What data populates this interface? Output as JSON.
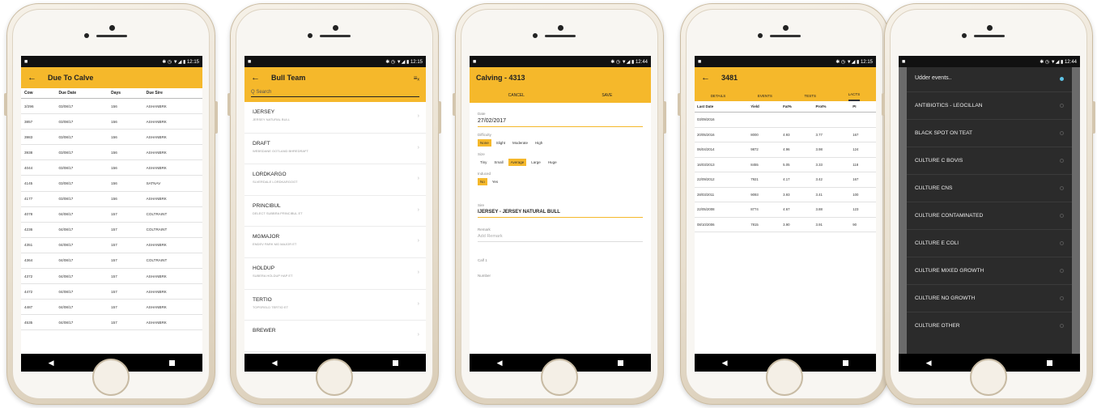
{
  "status": {
    "left": "■",
    "right": "✱ ◷ ▼◢ ▮ 12:15",
    "right_alt": "✱ ◷ ▼◢ ▮ 12:44"
  },
  "nav": {
    "back": "◀"
  },
  "phone1": {
    "title": "Due To Calve",
    "columns": [
      "Cow",
      "Due Date",
      "Days",
      "Due Sire"
    ],
    "rows": [
      [
        "3/296",
        "03/08/17",
        "156",
        "ASHANBRK"
      ],
      [
        "3857",
        "03/08/17",
        "156",
        "ASHANBRK"
      ],
      [
        "3983",
        "03/08/17",
        "156",
        "ASHANBRK"
      ],
      [
        "3938",
        "03/08/17",
        "156",
        "ASHANBRK"
      ],
      [
        "4044",
        "03/08/17",
        "156",
        "ASHANBRK"
      ],
      [
        "4145",
        "03/08/17",
        "156",
        "SATNAV"
      ],
      [
        "4177",
        "03/08/17",
        "156",
        "ASHANBRK"
      ],
      [
        "4078",
        "04/08/17",
        "157",
        "COLTRAINT"
      ],
      [
        "4236",
        "04/08/17",
        "157",
        "COLTRAINT"
      ],
      [
        "4351",
        "04/08/17",
        "157",
        "ASHANBRK"
      ],
      [
        "4364",
        "04/08/17",
        "157",
        "COLTRAINT"
      ],
      [
        "4372",
        "04/08/17",
        "157",
        "ASHANBRK"
      ],
      [
        "4472",
        "04/08/17",
        "157",
        "ASHANBRK"
      ],
      [
        "4487",
        "04/08/17",
        "157",
        "ASHANBRK"
      ],
      [
        "4535",
        "04/08/17",
        "157",
        "ASHANBRK"
      ]
    ]
  },
  "phone2": {
    "title": "Bull Team",
    "action": "≡ₓ",
    "search_placeholder": "Q Search",
    "bulls": [
      {
        "name": "IJERSEY",
        "desc": "JERSEY NATURAL BULL"
      },
      {
        "name": "DRAFT",
        "desc": "WEBSDANE GOTLAND BHREDRAFT"
      },
      {
        "name": "LORDKARGO",
        "desc": "SLVERDALE LORDKARGOGT"
      },
      {
        "name": "PRINCIBUL",
        "desc": "DELECT SUBBRA PRINCIBUL ET"
      },
      {
        "name": "MGMAJOR",
        "desc": "ENDEV PARK MG MAJOR ET"
      },
      {
        "name": "HOLDUP",
        "desc": "SUBERA HOLDUP HAP ET"
      },
      {
        "name": "TERTIO",
        "desc": "TOPSFIELD TERTIO ET"
      },
      {
        "name": "BREWER",
        "desc": ""
      }
    ]
  },
  "phone3": {
    "title": "Calving - 4313",
    "cancel": "CANCEL",
    "save": "SAVE",
    "date_label": "Date",
    "date_value": "27/02/2017",
    "difficulty_label": "Difficulty",
    "difficulty_options": [
      "None",
      "Slight",
      "Moderate",
      "High"
    ],
    "size_label": "Size",
    "size_options": [
      "Tiny",
      "Small",
      "Average",
      "Large",
      "Huge"
    ],
    "induced_label": "Induced",
    "induced_options": [
      "No",
      "Yes"
    ],
    "sire_label": "Sire",
    "sire_value": "IJERSEY - JERSEY NATURAL BULL",
    "remark_label": "Remark",
    "remark_placeholder": "Add Remark",
    "calf_label": "Calf 1",
    "number_label": "Number"
  },
  "phone4": {
    "title": "3481",
    "tabs": [
      "DETAILS",
      "EVENTS",
      "TESTS",
      "LACTS"
    ],
    "columns": [
      "Last Date",
      "Yield",
      "Fat%",
      "Prot%",
      "PI"
    ],
    "rows": [
      [
        "03/09/2016",
        "",
        "",
        "",
        ""
      ],
      [
        "20/05/2016",
        "8000",
        "4.93",
        "3.77",
        "167"
      ],
      [
        "06/04/2014",
        "9872",
        "4.96",
        "3.98",
        "124"
      ],
      [
        "16/03/2013",
        "8455",
        "5.05",
        "3.33",
        "118"
      ],
      [
        "22/09/2012",
        "7921",
        "4.17",
        "3.42",
        "167"
      ],
      [
        "28/03/2011",
        "9093",
        "3.93",
        "3.41",
        "100"
      ],
      [
        "22/05/2008",
        "8774",
        "4.67",
        "3.88",
        "123"
      ],
      [
        "08/10/2006",
        "7815",
        "3.90",
        "3.91",
        "90"
      ]
    ]
  },
  "phone5": {
    "dialog_title": "Udder events..",
    "options": [
      "ANTIBIOTICS - LEOCILLAN",
      "BLACK SPOT ON TEAT",
      "CULTURE C BOVIS",
      "CULTURE CNS",
      "CULTURE CONTAMINATED",
      "CULTURE E COLI",
      "CULTURE MIXED GROWTH",
      "CULTURE NO GROWTH",
      "CULTURE OTHER"
    ]
  },
  "colors": {
    "accent": "#f5b82b",
    "statusbar": "#111111",
    "dialog": "#2b2b2b"
  }
}
